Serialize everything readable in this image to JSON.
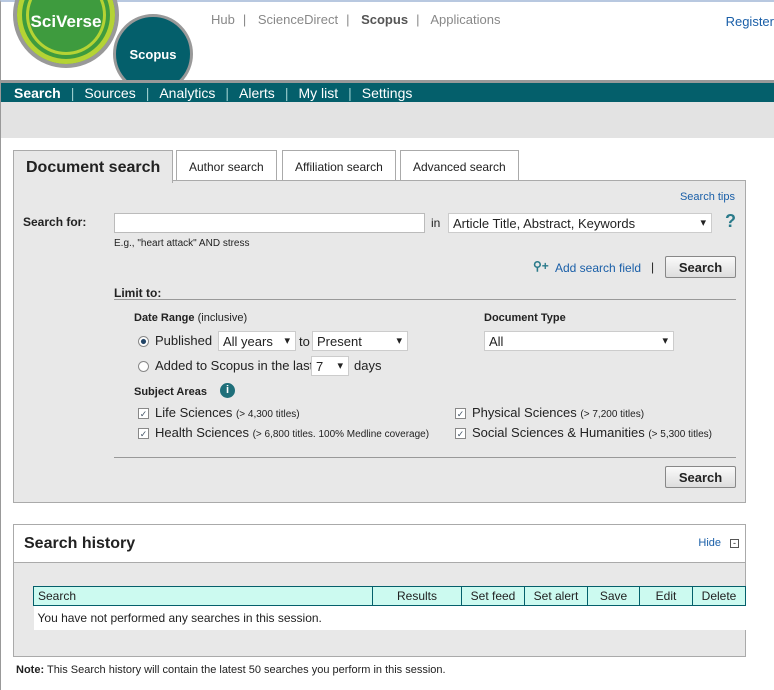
{
  "logo": {
    "sciverse": "SciVerse",
    "scopus": "Scopus"
  },
  "toplinks": [
    "Hub",
    "ScienceDirect",
    "Scopus",
    "Applications"
  ],
  "register": "Register",
  "nav": [
    "Search",
    "Sources",
    "Analytics",
    "Alerts",
    "My list",
    "Settings"
  ],
  "tabs": [
    "Document search",
    "Author search",
    "Affiliation search",
    "Advanced search"
  ],
  "form": {
    "search_tips": "Search tips",
    "search_for": "Search for:",
    "query": "",
    "in": "in",
    "field": "Article Title, Abstract, Keywords",
    "help": "?",
    "example": "E.g., \"heart attack\" AND stress",
    "add_field": "Add search field",
    "search": "Search",
    "limit_to": "Limit to:",
    "date_range": "Date Range",
    "inclusive": "(inclusive)",
    "published": "Published",
    "from": "All years",
    "to": "to",
    "to_value": "Present",
    "added": "Added to Scopus in the last",
    "days_value": "7",
    "days": "days",
    "doc_type": "Document Type",
    "doc_type_value": "All",
    "subject_areas": "Subject Areas",
    "subjects": [
      {
        "label": "Life Sciences",
        "note": "(> 4,300 titles)",
        "checked": true
      },
      {
        "label": "Health Sciences",
        "note": "(> 6,800 titles. 100% Medline coverage)",
        "checked": true
      },
      {
        "label": "Physical Sciences",
        "note": "(> 7,200 titles)",
        "checked": true
      },
      {
        "label": "Social Sciences & Humanities",
        "note": "(> 5,300 titles)",
        "checked": true
      }
    ]
  },
  "history": {
    "title": "Search history",
    "hide": "Hide",
    "columns": [
      "Search",
      "Results",
      "Set feed",
      "Set alert",
      "Save",
      "Edit",
      "Delete"
    ],
    "empty": "You have not performed any searches in this session.",
    "note_label": "Note:",
    "note": "This Search history will contain the latest 50 searches you perform in this session."
  }
}
